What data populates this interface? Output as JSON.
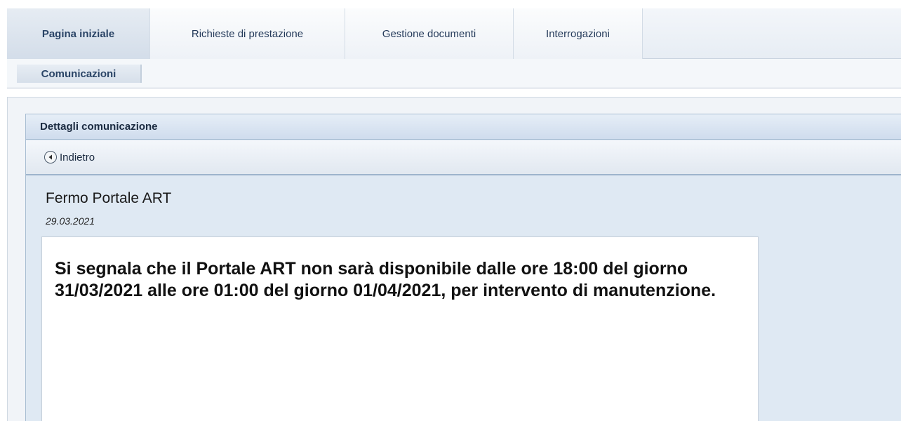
{
  "tabs": [
    {
      "label": "Pagina iniziale",
      "active": true
    },
    {
      "label": "Richieste di prestazione",
      "active": false
    },
    {
      "label": "Gestione documenti",
      "active": false
    },
    {
      "label": "Interrogazioni",
      "active": false
    }
  ],
  "subtabs": [
    {
      "label": "Comunicazioni",
      "active": true
    }
  ],
  "panel": {
    "header": "Dettagli comunicazione",
    "back_label": "Indietro",
    "back_icon": "arrow-left-circle-icon"
  },
  "message": {
    "title": "Fermo Portale ART",
    "date": "29.03.2021",
    "body": "Si segnala che il Portale ART non sarà disponibile dalle ore 18:00 del giorno 31/03/2021 alle ore 01:00 del giorno 01/04/2021, per intervento di manutenzione."
  },
  "colors": {
    "accent": "#2a4466",
    "panel_bg": "#dfe9f3"
  }
}
